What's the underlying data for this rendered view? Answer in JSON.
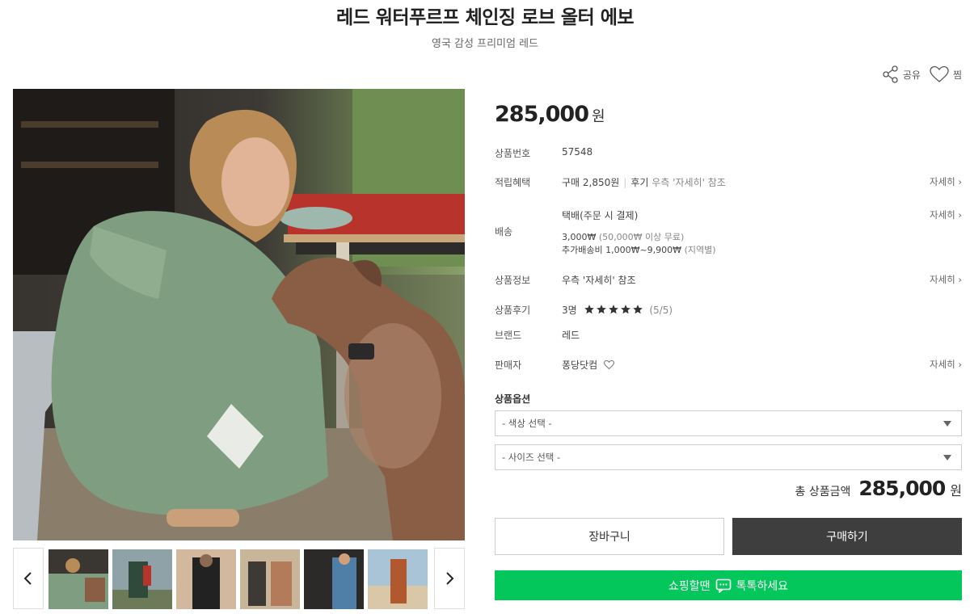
{
  "product": {
    "title": "레드 워터푸르프 체인징 로브 올터 에보",
    "subtitle": "영국 감성 프리미엄 레드"
  },
  "actions": {
    "share_label": "공유",
    "wish_label": "찜"
  },
  "price": {
    "amount": "285,000",
    "currency": "원"
  },
  "info": {
    "product_no": {
      "label": "상품번호",
      "value": "57548"
    },
    "points": {
      "label": "적립혜택",
      "purchase": "구매 2,850원",
      "review_strong": "후기",
      "review_rest": "우측 '자세히' 참조",
      "more": "자세히 ›"
    },
    "shipping": {
      "label": "배송",
      "method": "택배(주문 시 결제)",
      "fee": "3,000₩",
      "free": "(50,000₩ 이상 무료)",
      "extra": "추가배송비 1,000₩~9,900₩",
      "extra_region": "(지역별)",
      "more": "자세히 ›"
    },
    "product_info": {
      "label": "상품정보",
      "value": "우측 '자세히' 참조",
      "more": "자세히 ›"
    },
    "review": {
      "label": "상품후기",
      "count": "3명",
      "score": "(5/5)",
      "rating": 5,
      "max": 5
    },
    "brand": {
      "label": "브랜드",
      "value": "레드"
    },
    "seller": {
      "label": "판매자",
      "value": "퐁당닷컴",
      "more": "자세히 ›"
    }
  },
  "options": {
    "title": "상품옵션",
    "color_select": "- 색상 선택 -",
    "size_select": "- 사이즈 선택 -"
  },
  "total": {
    "label": "총 상품금액",
    "amount": "285,000",
    "currency": "원"
  },
  "buttons": {
    "cart": "장바구니",
    "buy": "구매하기",
    "talk_left": "쇼핑할땐",
    "talk_right": "톡톡하세요"
  },
  "colors": {
    "accent_green": "#03c75a",
    "buy_button": "#3e3e3e",
    "robe_green": "#7f9d80"
  }
}
